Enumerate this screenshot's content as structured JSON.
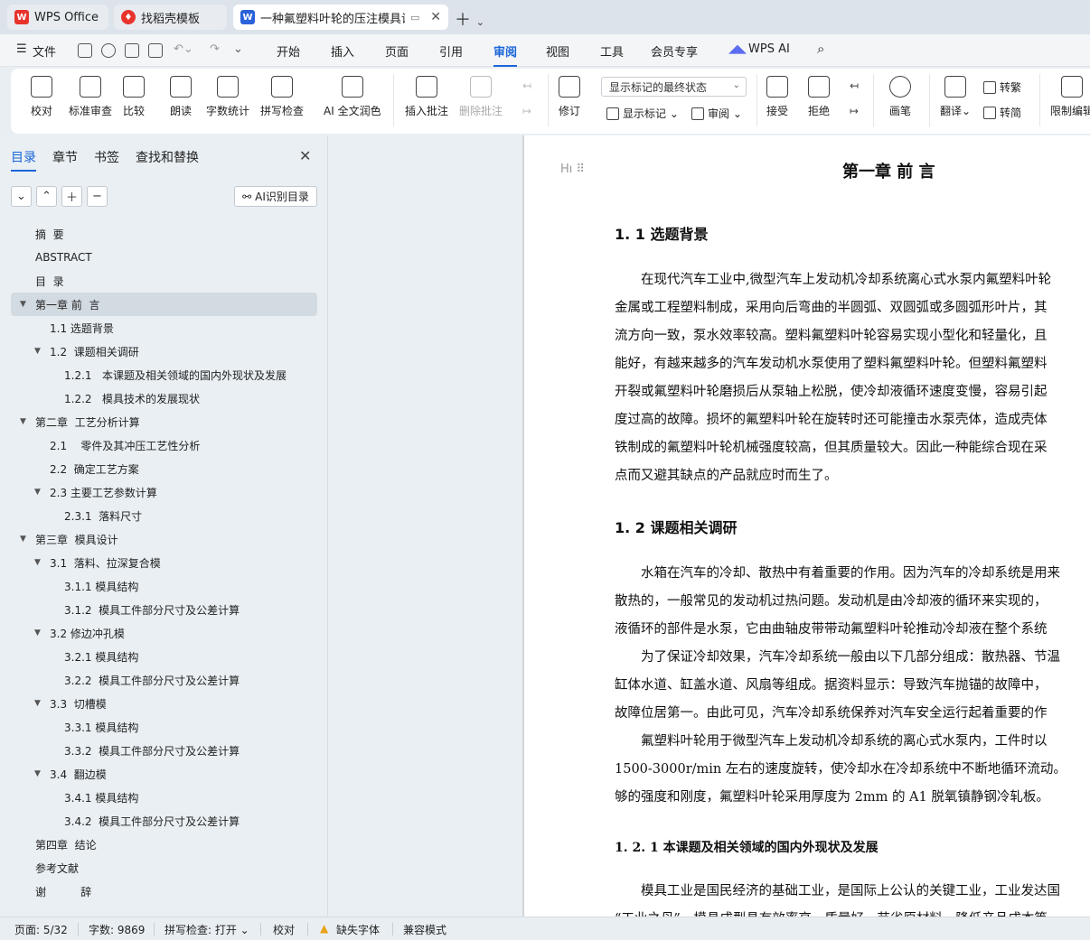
{
  "tabs": [
    {
      "label": "WPS Office",
      "icon": "wps-logo"
    },
    {
      "label": "找稻壳模板",
      "icon": "docer-logo"
    },
    {
      "label": "一种氟塑料叶轮的压注模具设",
      "icon": "word-logo",
      "active": true
    }
  ],
  "menu": {
    "file": "文件",
    "items": [
      "开始",
      "插入",
      "页面",
      "引用",
      "审阅",
      "视图",
      "工具",
      "会员专享"
    ],
    "active": "审阅",
    "wpsai": "WPS AI"
  },
  "ribbon": {
    "proofread": "校对",
    "standard_review": "标准审查",
    "compare": "比较",
    "read_aloud": "朗读",
    "word_count": "字数统计",
    "spell_check": "拼写检查",
    "ai_polish": "AI 全文润色",
    "insert_comment": "插入批注",
    "delete_comment": "删除批注",
    "revise": "修订",
    "markup_mode": "显示标记的最终状态",
    "show_markup": "显示标记",
    "review": "审阅",
    "accept": "接受",
    "reject": "拒绝",
    "pen": "画笔",
    "translate": "翻译",
    "to_traditional": "转繁",
    "to_simplified": "转简",
    "restrict_edit": "限制编辑"
  },
  "nav": {
    "tabs": [
      "目录",
      "章节",
      "书签",
      "查找和替换"
    ],
    "active_tab": "目录",
    "ai_toc": "AI识别目录",
    "toc": [
      {
        "text": "摘  要",
        "level": 0,
        "tri": false
      },
      {
        "text": "ABSTRACT",
        "level": 0,
        "tri": false
      },
      {
        "text": "目  录",
        "level": 0,
        "tri": false
      },
      {
        "text": "第一章 前  言",
        "level": 0,
        "tri": true,
        "selected": true
      },
      {
        "text": "1.1 选题背景",
        "level": 1,
        "tri": false
      },
      {
        "text": "1.2  课题相关调研",
        "level": 1,
        "tri": true
      },
      {
        "text": "1.2.1   本课题及相关领域的国内外现状及发展",
        "level": 2,
        "tri": false
      },
      {
        "text": "1.2.2   模具技术的发展现状",
        "level": 2,
        "tri": false
      },
      {
        "text": "第二章  工艺分析计算",
        "level": 0,
        "tri": true
      },
      {
        "text": "2.1    零件及其冲压工艺性分析",
        "level": 1,
        "tri": false
      },
      {
        "text": "2.2  确定工艺方案",
        "level": 1,
        "tri": false
      },
      {
        "text": "2.3 主要工艺参数计算",
        "level": 1,
        "tri": true
      },
      {
        "text": "2.3.1  落料尺寸",
        "level": 2,
        "tri": false
      },
      {
        "text": "第三章  模具设计",
        "level": 0,
        "tri": true
      },
      {
        "text": "3.1  落料、拉深复合模",
        "level": 1,
        "tri": true
      },
      {
        "text": "3.1.1 模具结构",
        "level": 2,
        "tri": false
      },
      {
        "text": "3.1.2  模具工件部分尺寸及公差计算",
        "level": 2,
        "tri": false
      },
      {
        "text": "3.2 修边冲孔模",
        "level": 1,
        "tri": true
      },
      {
        "text": "3.2.1 模具结构",
        "level": 2,
        "tri": false
      },
      {
        "text": "3.2.2  模具工件部分尺寸及公差计算",
        "level": 2,
        "tri": false
      },
      {
        "text": "3.3  切槽模",
        "level": 1,
        "tri": true
      },
      {
        "text": "3.3.1 模具结构",
        "level": 2,
        "tri": false
      },
      {
        "text": "3.3.2  模具工件部分尺寸及公差计算",
        "level": 2,
        "tri": false
      },
      {
        "text": "3.4  翻边模",
        "level": 1,
        "tri": true
      },
      {
        "text": "3.4.1 模具结构",
        "level": 2,
        "tri": false
      },
      {
        "text": "3.4.2  模具工件部分尺寸及公差计算",
        "level": 2,
        "tri": false
      },
      {
        "text": "第四章  结论",
        "level": 0,
        "tri": false
      },
      {
        "text": "参考文献",
        "level": 0,
        "tri": false
      },
      {
        "text": "谢          辞",
        "level": 0,
        "tri": false
      }
    ]
  },
  "doc": {
    "title": "第一章  前    言",
    "h_1_1": "1. 1 选题背景",
    "p1": [
      "　　在现代汽车工业中,微型汽车上发动机冷却系统离心式水泵内氟塑料叶轮",
      "金属或工程塑料制成，采用向后弯曲的半圆弧、双圆弧或多圆弧形叶片，其",
      "流方向一致，泵水效率较高。塑料氟塑料叶轮容易实现小型化和轻量化，且",
      "能好，有越来越多的汽车发动机水泵使用了塑料氟塑料叶轮。但塑料氟塑料",
      "开裂或氟塑料叶轮磨损后从泵轴上松脱，使冷却液循环速度变慢，容易引起",
      "度过高的故障。损坏的氟塑料叶轮在旋转时还可能撞击水泵壳体，造成壳体",
      "铁制成的氟塑料叶轮机械强度较高，但其质量较大。因此一种能综合现在采",
      "点而又避其缺点的产品就应时而生了。"
    ],
    "h_1_2": "1. 2  课题相关调研",
    "p2": [
      "　　水箱在汽车的冷却、散热中有着重要的作用。因为汽车的冷却系统是用来",
      "散热的，一般常见的发动机过热问题。发动机是由冷却液的循环来实现的，",
      "液循环的部件是水泵，它由曲轴皮带带动氟塑料叶轮推动冷却液在整个系统",
      "　　为了保证冷却效果，汽车冷却系统一般由以下几部分组成：散热器、节温",
      "缸体水道、缸盖水道、风扇等组成。据资料显示：导致汽车抛锚的故障中，",
      "故障位居第一。由此可见，汽车冷却系统保养对汽车安全运行起着重要的作",
      "　　氟塑料叶轮用于微型汽车上发动机冷却系统的离心式水泵内，工件时以",
      "1500-3000r/min 左右的速度旋转，使冷却水在冷却系统中不断地循环流动。",
      "够的强度和刚度，氟塑料叶轮采用厚度为 2mm 的 A1 脱氧镇静钢冷轧板。"
    ],
    "h_1_2_1": "1. 2. 1    本课题及相关领域的国内外现状及发展",
    "p3": [
      "　　模具工业是国民经济的基础工业，是国际上公认的关键工业，工业发达国",
      "“工业之母”。模具成型具有效率高，质量好，节省原材料，降低产品成本等"
    ]
  },
  "status": {
    "page": "页面: 5/32",
    "words": "字数: 9869",
    "spell": "拼写检查: 打开",
    "proof": "校对",
    "missing_font": "缺失字体",
    "compat": "兼容模式"
  },
  "colors": {
    "accent": "#1a66d9",
    "wps_red": "#e8342c",
    "word_blue": "#2b62d9"
  }
}
